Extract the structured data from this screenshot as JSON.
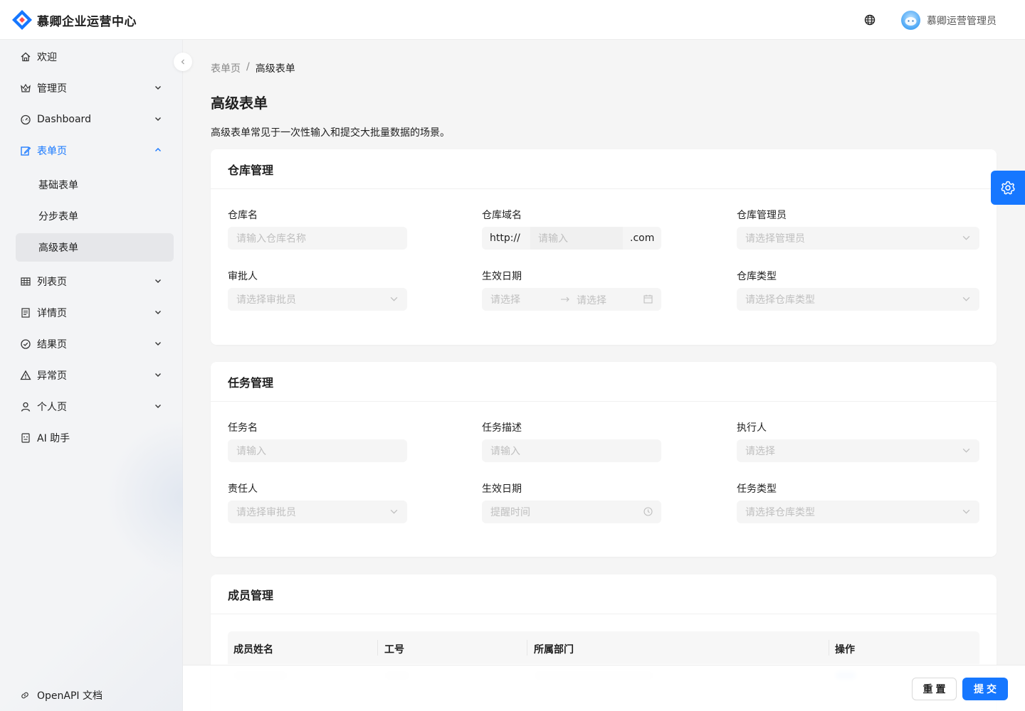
{
  "app": {
    "title": "慕卿企业运营中心",
    "user_name": "慕卿运营管理员",
    "accent_color": "#1677ff"
  },
  "sidebar": {
    "items": [
      {
        "label": "欢迎",
        "icon": "home-icon"
      },
      {
        "label": "管理页",
        "icon": "crown-icon"
      },
      {
        "label": "Dashboard",
        "icon": "dashboard-icon"
      },
      {
        "label": "表单页",
        "icon": "form-icon",
        "active": true
      },
      {
        "label": "列表页",
        "icon": "table-icon"
      },
      {
        "label": "详情页",
        "icon": "profile-icon"
      },
      {
        "label": "结果页",
        "icon": "check-circle-icon"
      },
      {
        "label": "异常页",
        "icon": "warning-icon"
      },
      {
        "label": "个人页",
        "icon": "user-icon"
      },
      {
        "label": "AI 助手",
        "icon": "robot-icon"
      }
    ],
    "sub_items": [
      "基础表单",
      "分步表单",
      "高级表单"
    ],
    "selected_sub": "高级表单",
    "footer_link": "OpenAPI 文档"
  },
  "breadcrumb": [
    "表单页",
    "/",
    "高级表单"
  ],
  "page": {
    "title": "高级表单",
    "description": "高级表单常见于一次性输入和提交大批量数据的场景。"
  },
  "warehouse": {
    "title": "仓库管理",
    "name_label": "仓库名",
    "name_placeholder": "请输入仓库名称",
    "domain_label": "仓库域名",
    "domain_prefix": "http://",
    "domain_placeholder": "请输入",
    "domain_suffix": ".com",
    "admin_label": "仓库管理员",
    "admin_placeholder": "请选择管理员",
    "approver_label": "审批人",
    "approver_placeholder": "请选择审批员",
    "date_label": "生效日期",
    "date_start_placeholder": "请选择",
    "date_end_placeholder": "请选择",
    "type_label": "仓库类型",
    "type_placeholder": "请选择仓库类型"
  },
  "task": {
    "title": "任务管理",
    "name_label": "任务名",
    "name_placeholder": "请输入",
    "desc_label": "任务描述",
    "desc_placeholder": "请输入",
    "executor_label": "执行人",
    "executor_placeholder": "请选择",
    "owner_label": "责任人",
    "owner_placeholder": "请选择审批员",
    "date_label": "生效日期",
    "date_placeholder": "提醒时间",
    "type_label": "任务类型",
    "type_placeholder": "请选择仓库类型"
  },
  "member": {
    "title": "成员管理",
    "columns": [
      "成员姓名",
      "工号",
      "所属部门",
      "操作"
    ]
  },
  "footer": {
    "reset": "重置",
    "submit": "提交"
  }
}
